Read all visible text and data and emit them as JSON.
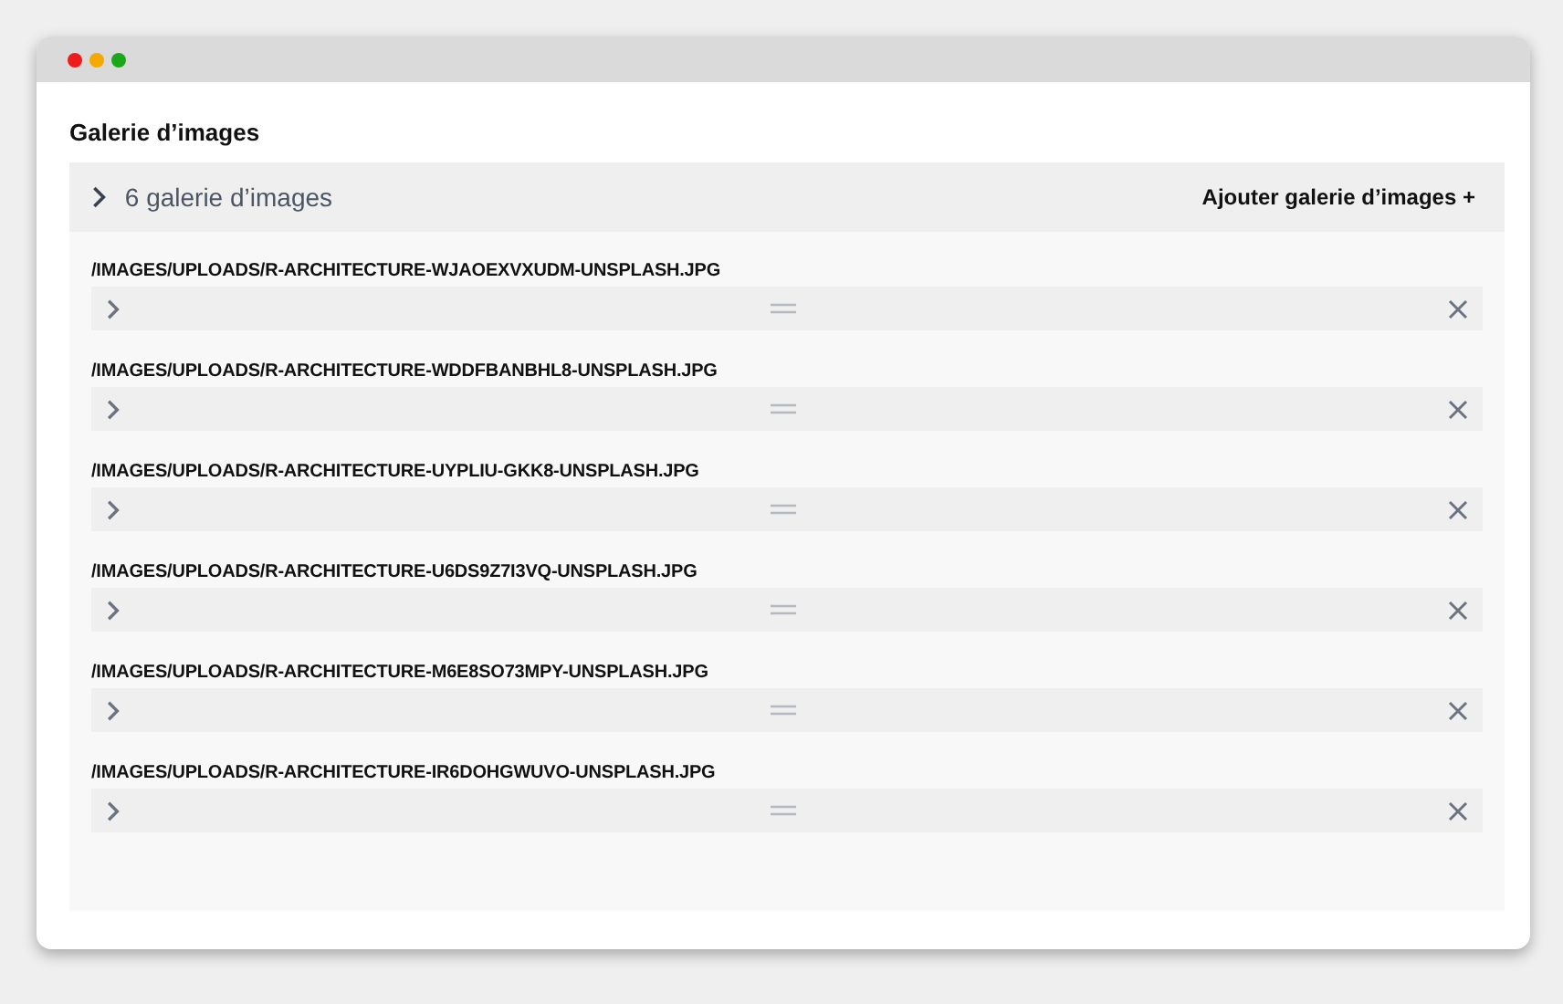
{
  "field": {
    "label": "Galerie d’images"
  },
  "list_header": {
    "summary": "6 galerie d’images",
    "add_button": "Ajouter galerie d’images +"
  },
  "items": [
    {
      "path": "/IMAGES/UPLOADS/R-ARCHITECTURE-WJAOEXVXUDM-UNSPLASH.JPG"
    },
    {
      "path": "/IMAGES/UPLOADS/R-ARCHITECTURE-WDDFBANBHL8-UNSPLASH.JPG"
    },
    {
      "path": "/IMAGES/UPLOADS/R-ARCHITECTURE-UYPLIU-GKK8-UNSPLASH.JPG"
    },
    {
      "path": "/IMAGES/UPLOADS/R-ARCHITECTURE-U6DS9Z7I3VQ-UNSPLASH.JPG"
    },
    {
      "path": "/IMAGES/UPLOADS/R-ARCHITECTURE-M6E8SO73MPY-UNSPLASH.JPG"
    },
    {
      "path": "/IMAGES/UPLOADS/R-ARCHITECTURE-IR6DOHGWUVO-UNSPLASH.JPG"
    }
  ]
}
